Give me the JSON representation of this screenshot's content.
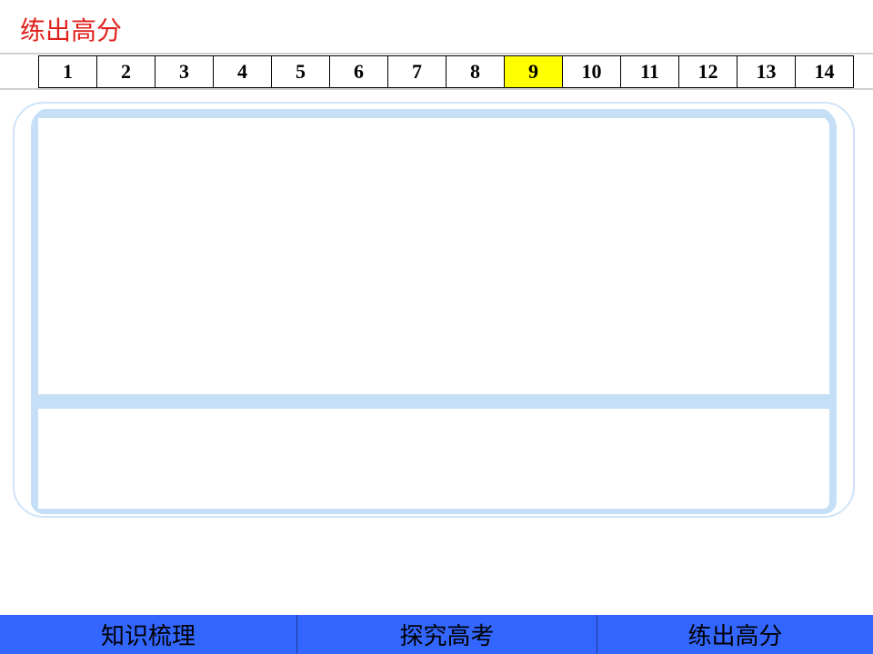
{
  "header": {
    "title": "练出高分",
    "title_color": "#e0201b"
  },
  "question_nav": {
    "items": [
      "1",
      "2",
      "3",
      "4",
      "5",
      "6",
      "7",
      "8",
      "9",
      "10",
      "11",
      "12",
      "13",
      "14"
    ],
    "active": "9",
    "active_color": "#ffff00"
  },
  "footer": {
    "background": "#3366ff",
    "items": [
      {
        "label": "知识梳理"
      },
      {
        "label": "探究高考"
      },
      {
        "label": "练出高分"
      }
    ]
  },
  "frame": {
    "accent_color": "#c5dff7"
  }
}
